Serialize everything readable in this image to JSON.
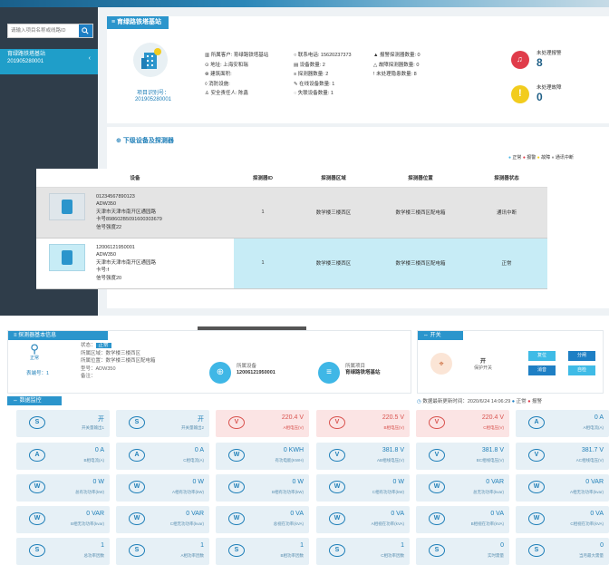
{
  "sidebar": {
    "search_placeholder": "请输入项目名称或线路ID",
    "item_name": "育绿路铁塔基站",
    "item_id": "201905280001"
  },
  "project": {
    "header": "≡ 育绿路铁塔基站",
    "code_label": "项目识别号：",
    "code": "201905280001",
    "col1": [
      "所属客户: 育绿路铁塔基站",
      "地址: 上海安和瑞",
      "建筑面积:",
      "消防设施:",
      "安全责任人: 陈鑫"
    ],
    "col2": [
      "联系电话: 15620237373",
      "设备数量: 2",
      "探测器数量: 2",
      "在线设备数量: 1",
      "失联设备数量: 1"
    ],
    "col3": [
      "报警探测器数量: 0",
      "故障探测器数量: 0",
      "未处理隐患数量: 8"
    ],
    "alerts": [
      {
        "label": "未处理报警",
        "value": "8",
        "color": "#e03c4a"
      },
      {
        "label": "未处理故障",
        "value": "0",
        "color": "#f2cc1e"
      }
    ]
  },
  "devices_section": {
    "title": "下级设备及探测器",
    "legend": [
      {
        "label": "正常",
        "color": "#4cb7e6"
      },
      {
        "label": "报警",
        "color": "#e03c4a"
      },
      {
        "label": "故障",
        "color": "#f2cc1e"
      },
      {
        "label": "通讯中断",
        "color": "#9a9a9a"
      }
    ],
    "columns": [
      "设备",
      "探测器ID",
      "探测器区域",
      "探测器位置",
      "探测器状态"
    ],
    "rows": [
      {
        "lines": [
          "01234567890123",
          "ADW350",
          "天津市天津市南开区通园路",
          "卡号898602B5091600303679",
          "信号强度22"
        ],
        "id": "1",
        "area": "数学楼三楼西区",
        "pos": "数学楼三楼西区配电箱",
        "status": "通讯中断"
      },
      {
        "lines": [
          "12006121950001",
          "ADW350",
          "天津市天津市南开区通园路",
          "卡号:f",
          "信号强度20"
        ],
        "id": "1",
        "area": "数学楼三楼西区",
        "pos": "数学楼三楼西区配电箱",
        "status": "正常"
      }
    ]
  },
  "detector": {
    "title": "≡ 探测器基本信息",
    "status_label": "状态：",
    "status": "正常",
    "area": "所属区域：数学楼三楼西区",
    "pos": "所属位置：数学楼三楼西区配电箱",
    "model": "型号：ADW350",
    "remark": "备注：",
    "icon_text": "正常",
    "loop": "表端号：1",
    "device_label": "所属设备",
    "device_value": "12006121950001",
    "project_label": "所属项目",
    "project_value": "育绿路铁塔基站"
  },
  "switch_panel": {
    "title": "⇔ 开关",
    "state": "开",
    "name": "保护开关",
    "buttons": [
      {
        "label": "复位",
        "color": "#3fbbe6"
      },
      {
        "label": "分闸",
        "color": "#1e7fc4"
      },
      {
        "label": "消音",
        "color": "#1e7fc4"
      },
      {
        "label": "自检",
        "color": "#3fbbe6"
      }
    ]
  },
  "monitor": {
    "title": "⇔ 数据监控",
    "update_text": "数据最新更新时间：2020/6/24 14:06:29",
    "legend": [
      {
        "label": "正常",
        "color": "#1e7fc4"
      },
      {
        "label": "报警",
        "color": "#e03c4a"
      }
    ],
    "tiles": [
      {
        "icon": "S",
        "value": "开",
        "label": "开关量输出1",
        "red": false
      },
      {
        "icon": "S",
        "value": "开",
        "label": "开关量输出2",
        "red": false
      },
      {
        "icon": "V",
        "value": "220.4 V",
        "label": "A相电压(V)",
        "red": true
      },
      {
        "icon": "V",
        "value": "220.5 V",
        "label": "B相电压(V)",
        "red": true
      },
      {
        "icon": "V",
        "value": "220.4 V",
        "label": "C相电压(V)",
        "red": true
      },
      {
        "icon": "A",
        "value": "0 A",
        "label": "A相电流(A)",
        "red": false
      },
      {
        "icon": "A",
        "value": "0 A",
        "label": "B相电流(A)",
        "red": false
      },
      {
        "icon": "A",
        "value": "0 A",
        "label": "C相电流(A)",
        "red": false
      },
      {
        "icon": "W",
        "value": "0 KWH",
        "label": "有功电能(KWH)",
        "red": false
      },
      {
        "icon": "V",
        "value": "381.8 V",
        "label": "AB相线电压(V)",
        "red": false
      },
      {
        "icon": "V",
        "value": "381.8 V",
        "label": "BC相线电压(V)",
        "red": false
      },
      {
        "icon": "V",
        "value": "381.7 V",
        "label": "AC相线电压(V)",
        "red": false
      },
      {
        "icon": "W",
        "value": "0 W",
        "label": "总有功功率(kW)",
        "red": false
      },
      {
        "icon": "W",
        "value": "0 W",
        "label": "A相有功功率(kW)",
        "red": false
      },
      {
        "icon": "W",
        "value": "0 W",
        "label": "B相有功功率(kW)",
        "red": false
      },
      {
        "icon": "W",
        "value": "0 W",
        "label": "C相有功功率(kW)",
        "red": false
      },
      {
        "icon": "W",
        "value": "0 VAR",
        "label": "总无功功率(kvar)",
        "red": false
      },
      {
        "icon": "W",
        "value": "0 VAR",
        "label": "A相无功功率(kvar)",
        "red": false
      },
      {
        "icon": "W",
        "value": "0 VAR",
        "label": "B相无功功率(kvar)",
        "red": false
      },
      {
        "icon": "W",
        "value": "0 VAR",
        "label": "C相无功功率(kvar)",
        "red": false
      },
      {
        "icon": "W",
        "value": "0 VA",
        "label": "总视在功率(kVA)",
        "red": false
      },
      {
        "icon": "W",
        "value": "0 VA",
        "label": "A相视在功率(kVA)",
        "red": false
      },
      {
        "icon": "W",
        "value": "0 VA",
        "label": "B相视在功率(kVA)",
        "red": false
      },
      {
        "icon": "W",
        "value": "0 VA",
        "label": "C相视在功率(kVA)",
        "red": false
      },
      {
        "icon": "S",
        "value": "1",
        "label": "总功率因数",
        "red": false
      },
      {
        "icon": "S",
        "value": "1",
        "label": "A相功率因数",
        "red": false
      },
      {
        "icon": "S",
        "value": "1",
        "label": "B相功率因数",
        "red": false
      },
      {
        "icon": "S",
        "value": "1",
        "label": "C相功率因数",
        "red": false
      },
      {
        "icon": "S",
        "value": "0",
        "label": "实时需量",
        "red": false
      },
      {
        "icon": "S",
        "value": "0",
        "label": "当月最大需量",
        "red": false
      }
    ]
  }
}
